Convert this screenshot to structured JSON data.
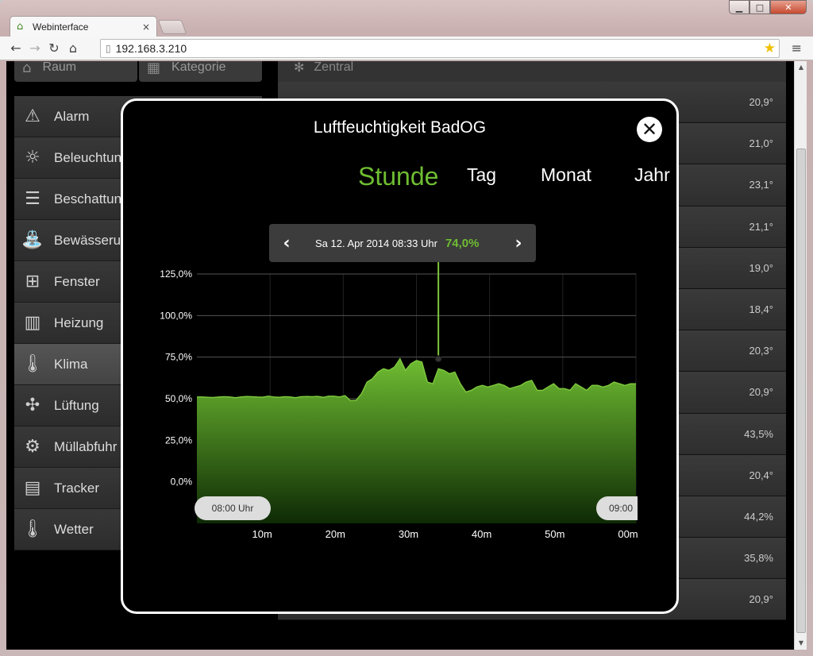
{
  "browser": {
    "tab_title": "Webinterface",
    "tab_close": "×",
    "url": "192.168.3.210",
    "win_min": "▁",
    "win_max": "□",
    "win_close": "✕"
  },
  "nav_top": [
    {
      "label": "Raum",
      "icon": "house-icon"
    },
    {
      "label": "Kategorie",
      "icon": "grid-icon"
    }
  ],
  "sidebar": {
    "items": [
      {
        "label": "Alarm",
        "icon": "siren-icon",
        "active": false
      },
      {
        "label": "Beleuchtun",
        "icon": "sun-icon",
        "active": false
      },
      {
        "label": "Beschattun",
        "icon": "shutter-icon",
        "active": false
      },
      {
        "label": "Bewässeru",
        "icon": "watering-can-icon",
        "active": false
      },
      {
        "label": "Fenster",
        "icon": "window-icon",
        "active": false
      },
      {
        "label": "Heizung",
        "icon": "radiator-icon",
        "active": false
      },
      {
        "label": "Klima",
        "icon": "thermometer-icon",
        "active": true
      },
      {
        "label": "Lüftung",
        "icon": "fan-icon",
        "active": false
      },
      {
        "label": "Müllabfuhr",
        "icon": "gear-icon",
        "active": false
      },
      {
        "label": "Tracker",
        "icon": "tracker-icon",
        "active": false
      },
      {
        "label": "Wetter",
        "icon": "thermometer-icon",
        "active": false
      }
    ]
  },
  "right_panel": {
    "header": "Zentral",
    "values": [
      "20,9°",
      "21,0°",
      "23,1°",
      "21,1°",
      "19,0°",
      "18,4°",
      "20,3°",
      "20,9°",
      "43,5%",
      "20,4°",
      "44,2%",
      "35,8%",
      "20,9°"
    ]
  },
  "modal": {
    "title": "Luftfeuchtigkeit BadOG",
    "close": "✕",
    "ranges": [
      {
        "label": "Stunde",
        "active": true
      },
      {
        "label": "Tag",
        "active": false
      },
      {
        "label": "Monat",
        "active": false
      },
      {
        "label": "Jahr",
        "active": false
      }
    ],
    "tooltip": {
      "prev": "‹",
      "next": "›",
      "date": "Sa 12. Apr 2014 08:33 Uhr",
      "value": "74,0%"
    },
    "start_label": "08:00 Uhr",
    "end_label": "09:00"
  },
  "chart_data": {
    "type": "area",
    "x_unit": "minutes after 08:00",
    "x": [
      0,
      1,
      2,
      3,
      4,
      5,
      6,
      7,
      8,
      9,
      10,
      11,
      12,
      13,
      14,
      15,
      16,
      17,
      18,
      19,
      20,
      21,
      22,
      23,
      24,
      25,
      26,
      27,
      28,
      29,
      30,
      31,
      32,
      33,
      34,
      35,
      36,
      37,
      38,
      39,
      40,
      41,
      42,
      43,
      44,
      45,
      46,
      47,
      48,
      49,
      50,
      51,
      52,
      53,
      54,
      55,
      56,
      57,
      58,
      59,
      60
    ],
    "values": [
      51,
      51,
      50.8,
      50.7,
      51,
      51.2,
      51,
      50.6,
      51,
      51.3,
      51.2,
      51,
      50.9,
      51.5,
      51,
      50.8,
      51.2,
      51,
      50.6,
      51.2,
      51.3,
      51.2,
      51.4,
      50.8,
      51.5,
      51.5,
      51,
      51.8,
      48.8,
      49,
      53,
      60,
      62,
      66,
      68,
      67,
      69,
      74,
      67,
      71,
      73,
      72,
      60,
      59,
      68,
      67,
      65,
      66,
      59,
      54,
      55,
      57,
      58,
      57,
      58,
      59,
      58,
      56,
      57,
      58,
      60,
      61,
      55,
      55,
      57,
      59,
      56,
      56,
      55,
      59,
      57,
      55,
      58,
      58,
      57,
      58,
      60,
      59,
      58,
      59,
      59
    ],
    "series": [
      {
        "name": "Luftfeuchtigkeit BadOG"
      }
    ],
    "y_ticks": [
      "125,0%",
      "100,0%",
      "75,0%",
      "50,0%",
      "25,0%",
      "0,0%"
    ],
    "y_tick_values": [
      125,
      100,
      75,
      50,
      25,
      0
    ],
    "x_ticks": [
      "10m",
      "20m",
      "30m",
      "40m",
      "50m",
      "00m"
    ],
    "x_tick_values": [
      10,
      20,
      30,
      40,
      50,
      60
    ],
    "ylim": [
      -25,
      125
    ],
    "xlim": [
      0,
      60
    ],
    "highlight": {
      "x": 33,
      "y": 74
    },
    "colors": {
      "fill_top": "#6fbd32",
      "fill_bottom": "#0e2a05",
      "line": "#7cc63c",
      "grid": "#555555"
    }
  }
}
